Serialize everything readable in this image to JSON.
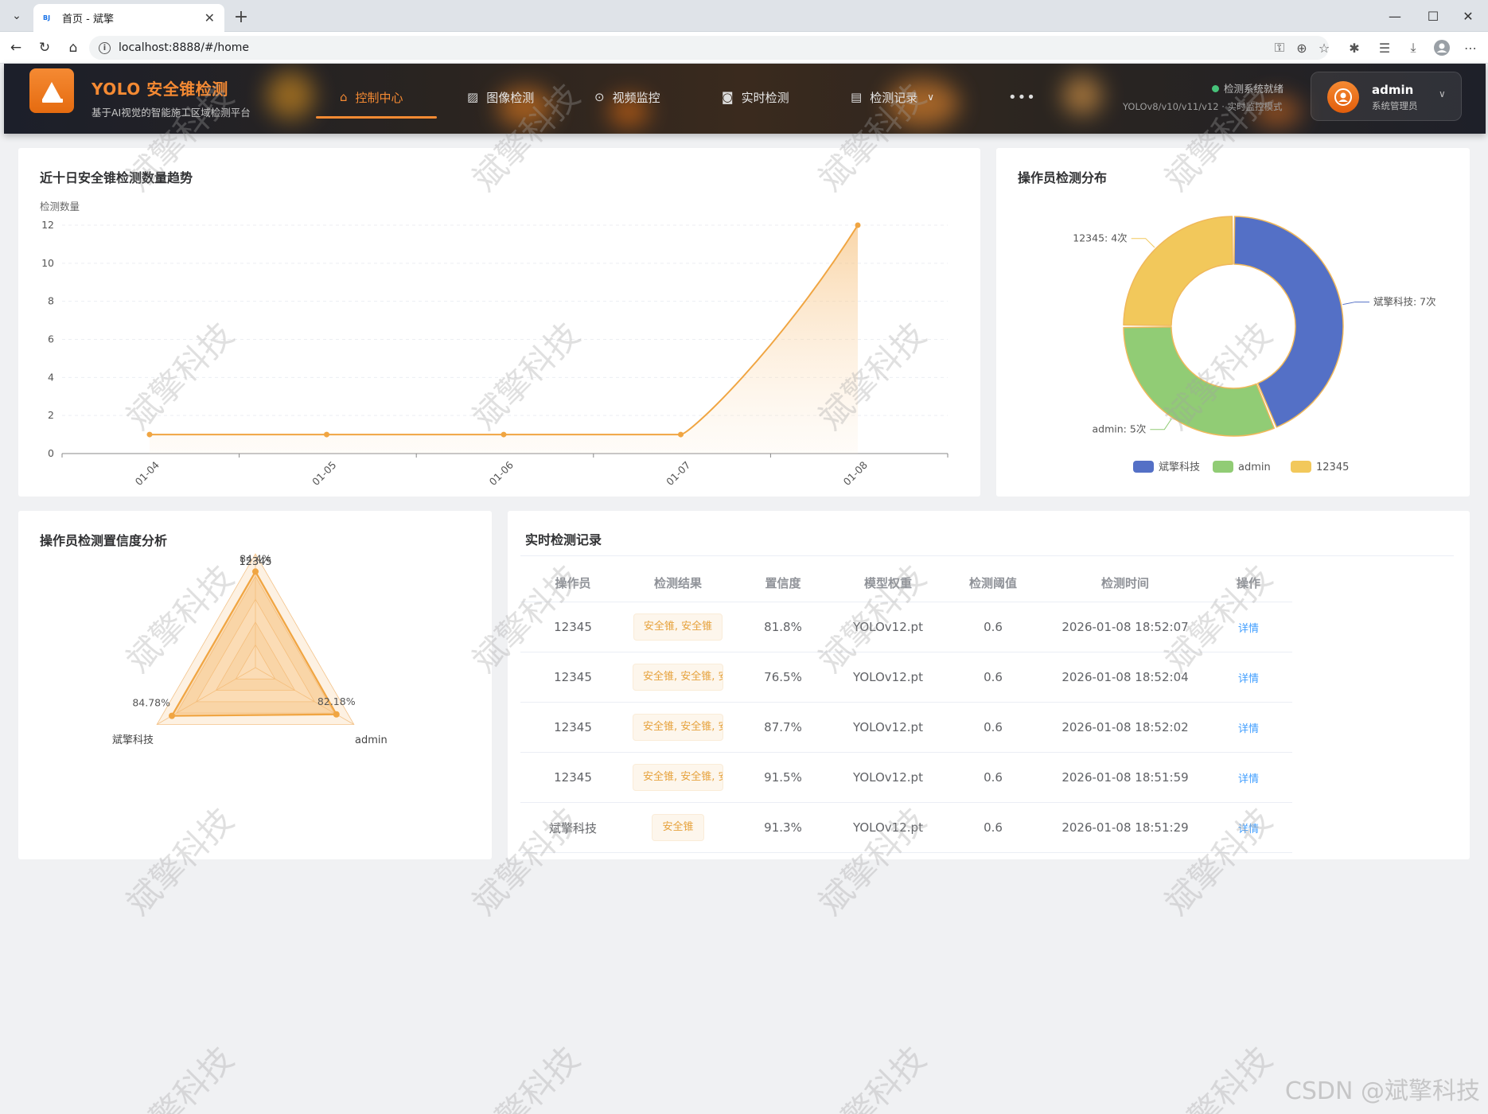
{
  "browser": {
    "tab_title": "首页 - 斌擎",
    "favicon_text": "BJ",
    "url": "localhost:8888/#/home"
  },
  "header": {
    "title": "YOLO 安全锥检测",
    "subtitle": "基于AI视觉的智能施工区域检测平台",
    "nav": [
      {
        "label": "控制中心",
        "icon": "home-icon",
        "active": true
      },
      {
        "label": "图像检测",
        "icon": "image-icon",
        "active": false
      },
      {
        "label": "视频监控",
        "icon": "play-icon",
        "active": false
      },
      {
        "label": "实时检测",
        "icon": "camera-icon",
        "active": false
      },
      {
        "label": "检测记录",
        "icon": "document-icon",
        "active": false
      }
    ],
    "more": "•••",
    "status_text": "检测系统就绪",
    "model_text": "YOLOv8/v10/v11/v12 · 实时监控模式",
    "user": {
      "name": "admin",
      "role": "系统管理员"
    },
    "colors": {
      "accent": "#f58a33",
      "status": "#47c27a"
    }
  },
  "trend": {
    "title": "近十日安全锥检测数量趋势",
    "chart_data": {
      "type": "line",
      "ylabel": "检测数量",
      "x": [
        "01-04",
        "01-05",
        "01-06",
        "01-07",
        "01-08"
      ],
      "series": [
        {
          "values": [
            1,
            1,
            1,
            1,
            12
          ]
        }
      ],
      "ylim": [
        0,
        12
      ],
      "yticks": [
        0,
        2,
        4,
        6,
        8,
        10,
        12
      ],
      "smooth": true,
      "area_fill": true,
      "color": "#f0a542",
      "grid": "horizontal dashed"
    }
  },
  "distribution": {
    "title": "操作员检测分布",
    "chart_data": {
      "type": "pie",
      "donut": true,
      "slices": [
        {
          "name": "斌擎科技",
          "value": 7,
          "label": "斌擎科技: 7次",
          "color": "#5470c6"
        },
        {
          "name": "admin",
          "value": 5,
          "label": "admin: 5次",
          "color": "#91cc75"
        },
        {
          "name": "12345",
          "value": 4,
          "label": "12345: 4次",
          "color": "#f2c85b"
        }
      ],
      "legend_position": "bottom"
    }
  },
  "confidence": {
    "title": "操作员检测置信度分析",
    "chart_data": {
      "type": "radar",
      "indicators": [
        "12345",
        "admin",
        "斌擎科技"
      ],
      "values": [
        84.4,
        82.18,
        84.78
      ],
      "value_labels": [
        "84.4%",
        "82.18%",
        "84.78%"
      ],
      "max": 100,
      "color": "#f0a542"
    }
  },
  "records": {
    "title": "实时检测记录",
    "columns": [
      "操作员",
      "检测结果",
      "置信度",
      "模型权重",
      "检测阈值",
      "检测时间",
      "操作"
    ],
    "rows": [
      {
        "operator": "12345",
        "result": "安全锥, 安全锥",
        "confidence": "81.8%",
        "model": "YOLOv12.pt",
        "threshold": "0.6",
        "time": "2026-01-08 18:52:07",
        "action": "详情"
      },
      {
        "operator": "12345",
        "result": "安全锥, 安全锥, 安",
        "confidence": "76.5%",
        "model": "YOLOv12.pt",
        "threshold": "0.6",
        "time": "2026-01-08 18:52:04",
        "action": "详情"
      },
      {
        "operator": "12345",
        "result": "安全锥, 安全锥, 安",
        "confidence": "87.7%",
        "model": "YOLOv12.pt",
        "threshold": "0.6",
        "time": "2026-01-08 18:52:02",
        "action": "详情"
      },
      {
        "operator": "12345",
        "result": "安全锥, 安全锥, 安",
        "confidence": "91.5%",
        "model": "YOLOv12.pt",
        "threshold": "0.6",
        "time": "2026-01-08 18:51:59",
        "action": "详情"
      },
      {
        "operator": "斌擎科技",
        "result": "安全锥",
        "confidence": "91.3%",
        "model": "YOLOv12.pt",
        "threshold": "0.6",
        "time": "2026-01-08 18:51:29",
        "action": "详情"
      }
    ]
  },
  "watermark_text": "斌擎科技",
  "footer_watermark": "CSDN @斌擎科技"
}
